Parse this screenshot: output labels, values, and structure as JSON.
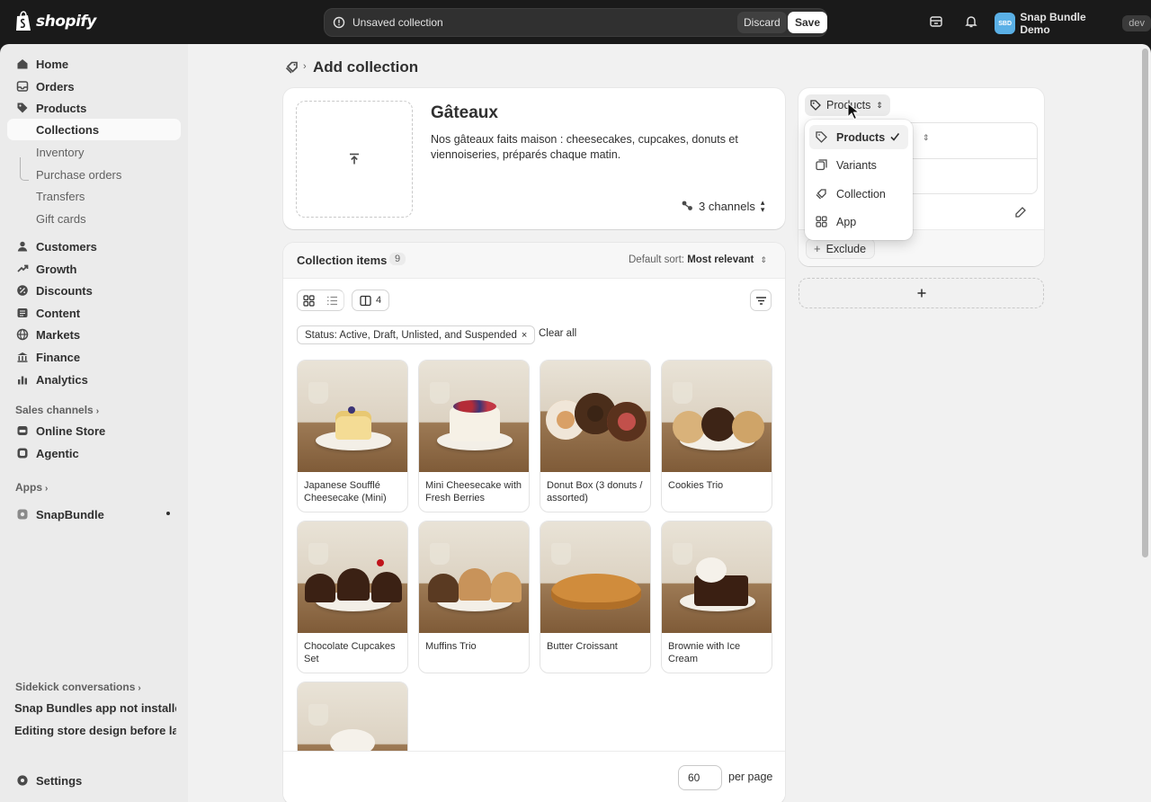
{
  "topbar": {
    "logo_text": "shopify",
    "savebar_title": "Unsaved collection",
    "discard_label": "Discard",
    "save_label": "Save",
    "store_initials": "SBD",
    "store_name": "Snap Bundle Demo",
    "env_badge": "dev"
  },
  "sidebar": {
    "items": [
      {
        "label": "Home",
        "icon": "home-icon"
      },
      {
        "label": "Orders",
        "icon": "orders-icon"
      },
      {
        "label": "Products",
        "icon": "tag-icon"
      },
      {
        "label": "Collections"
      },
      {
        "label": "Inventory"
      },
      {
        "label": "Purchase orders"
      },
      {
        "label": "Transfers"
      },
      {
        "label": "Gift cards"
      },
      {
        "label": "Customers",
        "icon": "person-icon"
      },
      {
        "label": "Growth",
        "icon": "growth-icon"
      },
      {
        "label": "Discounts",
        "icon": "discount-icon"
      },
      {
        "label": "Content",
        "icon": "content-icon"
      },
      {
        "label": "Markets",
        "icon": "globe-icon"
      },
      {
        "label": "Finance",
        "icon": "bank-icon"
      },
      {
        "label": "Analytics",
        "icon": "chart-icon"
      }
    ],
    "sales_channels_label": "Sales channels",
    "channels": [
      {
        "label": "Online Store",
        "icon": "store-icon"
      },
      {
        "label": "Agentic",
        "icon": "agentic-icon"
      }
    ],
    "apps_label": "Apps",
    "apps": [
      {
        "label": "SnapBundle",
        "icon": "app-icon"
      }
    ],
    "sidekick_label": "Sidekick conversations",
    "notes": [
      "Snap Bundles app not installed",
      "Editing store design before lau..."
    ],
    "settings_label": "Settings"
  },
  "page": {
    "title": "Add collection"
  },
  "collection": {
    "title": "Gâteaux",
    "description": "Nos gâteaux faits maison : cheesecakes, cupcakes, donuts et viennoiseries, préparés chaque matin.",
    "channels_label": "3 channels"
  },
  "items": {
    "title": "Collection items",
    "count": "9",
    "sort_prefix": "Default sort:",
    "sort_value": "Most relevant",
    "columns_label": "4",
    "filter_chip": "Status: Active, Draft, Unlisted, and Suspended",
    "clear_all": "Clear all",
    "products": [
      {
        "name": "Japanese Soufflé Cheesecake (Mini)"
      },
      {
        "name": "Mini Cheesecake with Fresh Berries"
      },
      {
        "name": "Donut Box (3 donuts / assorted)"
      },
      {
        "name": "Cookies Trio"
      },
      {
        "name": "Chocolate Cupcakes Set"
      },
      {
        "name": "Muffins Trio"
      },
      {
        "name": "Butter Croissant"
      },
      {
        "name": "Brownie with Ice Cream"
      },
      {
        "name": ""
      }
    ],
    "per_page_value": "60",
    "per_page_label": "per page"
  },
  "conditions": {
    "type_label": "Products",
    "exclude_label": "Exclude",
    "menu": [
      {
        "label": "Products",
        "selected": true
      },
      {
        "label": "Variants",
        "selected": false
      },
      {
        "label": "Collection",
        "selected": false
      },
      {
        "label": "App",
        "selected": false
      }
    ]
  },
  "colors": {
    "topbar_bg": "#1a1a1a",
    "sidebar_bg": "#ebebeb",
    "main_bg": "#f1f1f1",
    "card_bg": "#ffffff",
    "text": "#303030"
  }
}
